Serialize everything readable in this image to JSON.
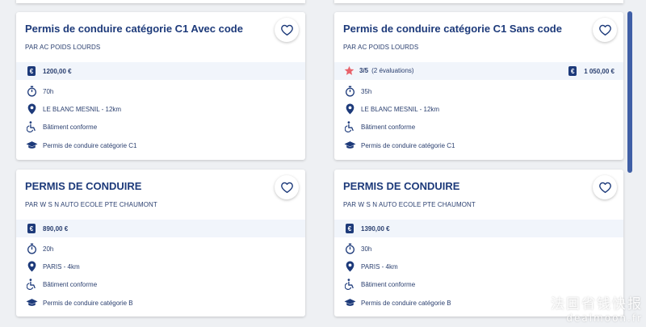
{
  "cards": [
    {
      "title": "Permis de conduire catégorie C1 Avec code",
      "org": "PAR AC POIDS LOURDS",
      "price": "1200,00 €",
      "duration": "70h",
      "location": "LE BLANC MESNIL - 12km",
      "accessibility": "Bâtiment conforme",
      "certification": "Permis de conduire catégorie C1"
    },
    {
      "title": "Permis de conduire catégorie C1 Sans code",
      "org": "PAR AC POIDS LOURDS",
      "rating": "3/5",
      "rating_count": "(2 évaluations)",
      "price": "1 050,00 €",
      "duration": "35h",
      "location": "LE BLANC MESNIL - 12km",
      "accessibility": "Bâtiment conforme",
      "certification": "Permis de conduire catégorie C1"
    },
    {
      "title": "PERMIS DE CONDUIRE",
      "org": "PAR W S N AUTO ECOLE PTE CHAUMONT",
      "price": "890,00 €",
      "duration": "20h",
      "location": "PARIS - 4km",
      "accessibility": "Bâtiment conforme",
      "certification": "Permis de conduire catégorie B"
    },
    {
      "title": "PERMIS DE CONDUIRE",
      "org": "PAR W S N AUTO ECOLE PTE CHAUMONT",
      "price": "1390,00 €",
      "duration": "30h",
      "location": "PARIS - 4km",
      "accessibility": "Bâtiment conforme",
      "certification": "Permis de conduire catégorie B"
    }
  ],
  "euro_glyph": "€",
  "icons": {
    "favorite": "heart-icon",
    "price": "euro-icon",
    "duration": "stopwatch-icon",
    "location": "map-pin-icon",
    "accessibility": "wheelchair-icon",
    "certification": "graduation-cap-icon",
    "rating": "star-icon"
  },
  "colors": {
    "title": "#1d3a7a",
    "text": "#2a3f6f",
    "band": "#f1f5fb",
    "star": "#e8636b",
    "scrollbar": "#3f5fa6"
  },
  "watermark": {
    "line1": "法国省钱快报",
    "line2": "dealmoon.fr"
  }
}
